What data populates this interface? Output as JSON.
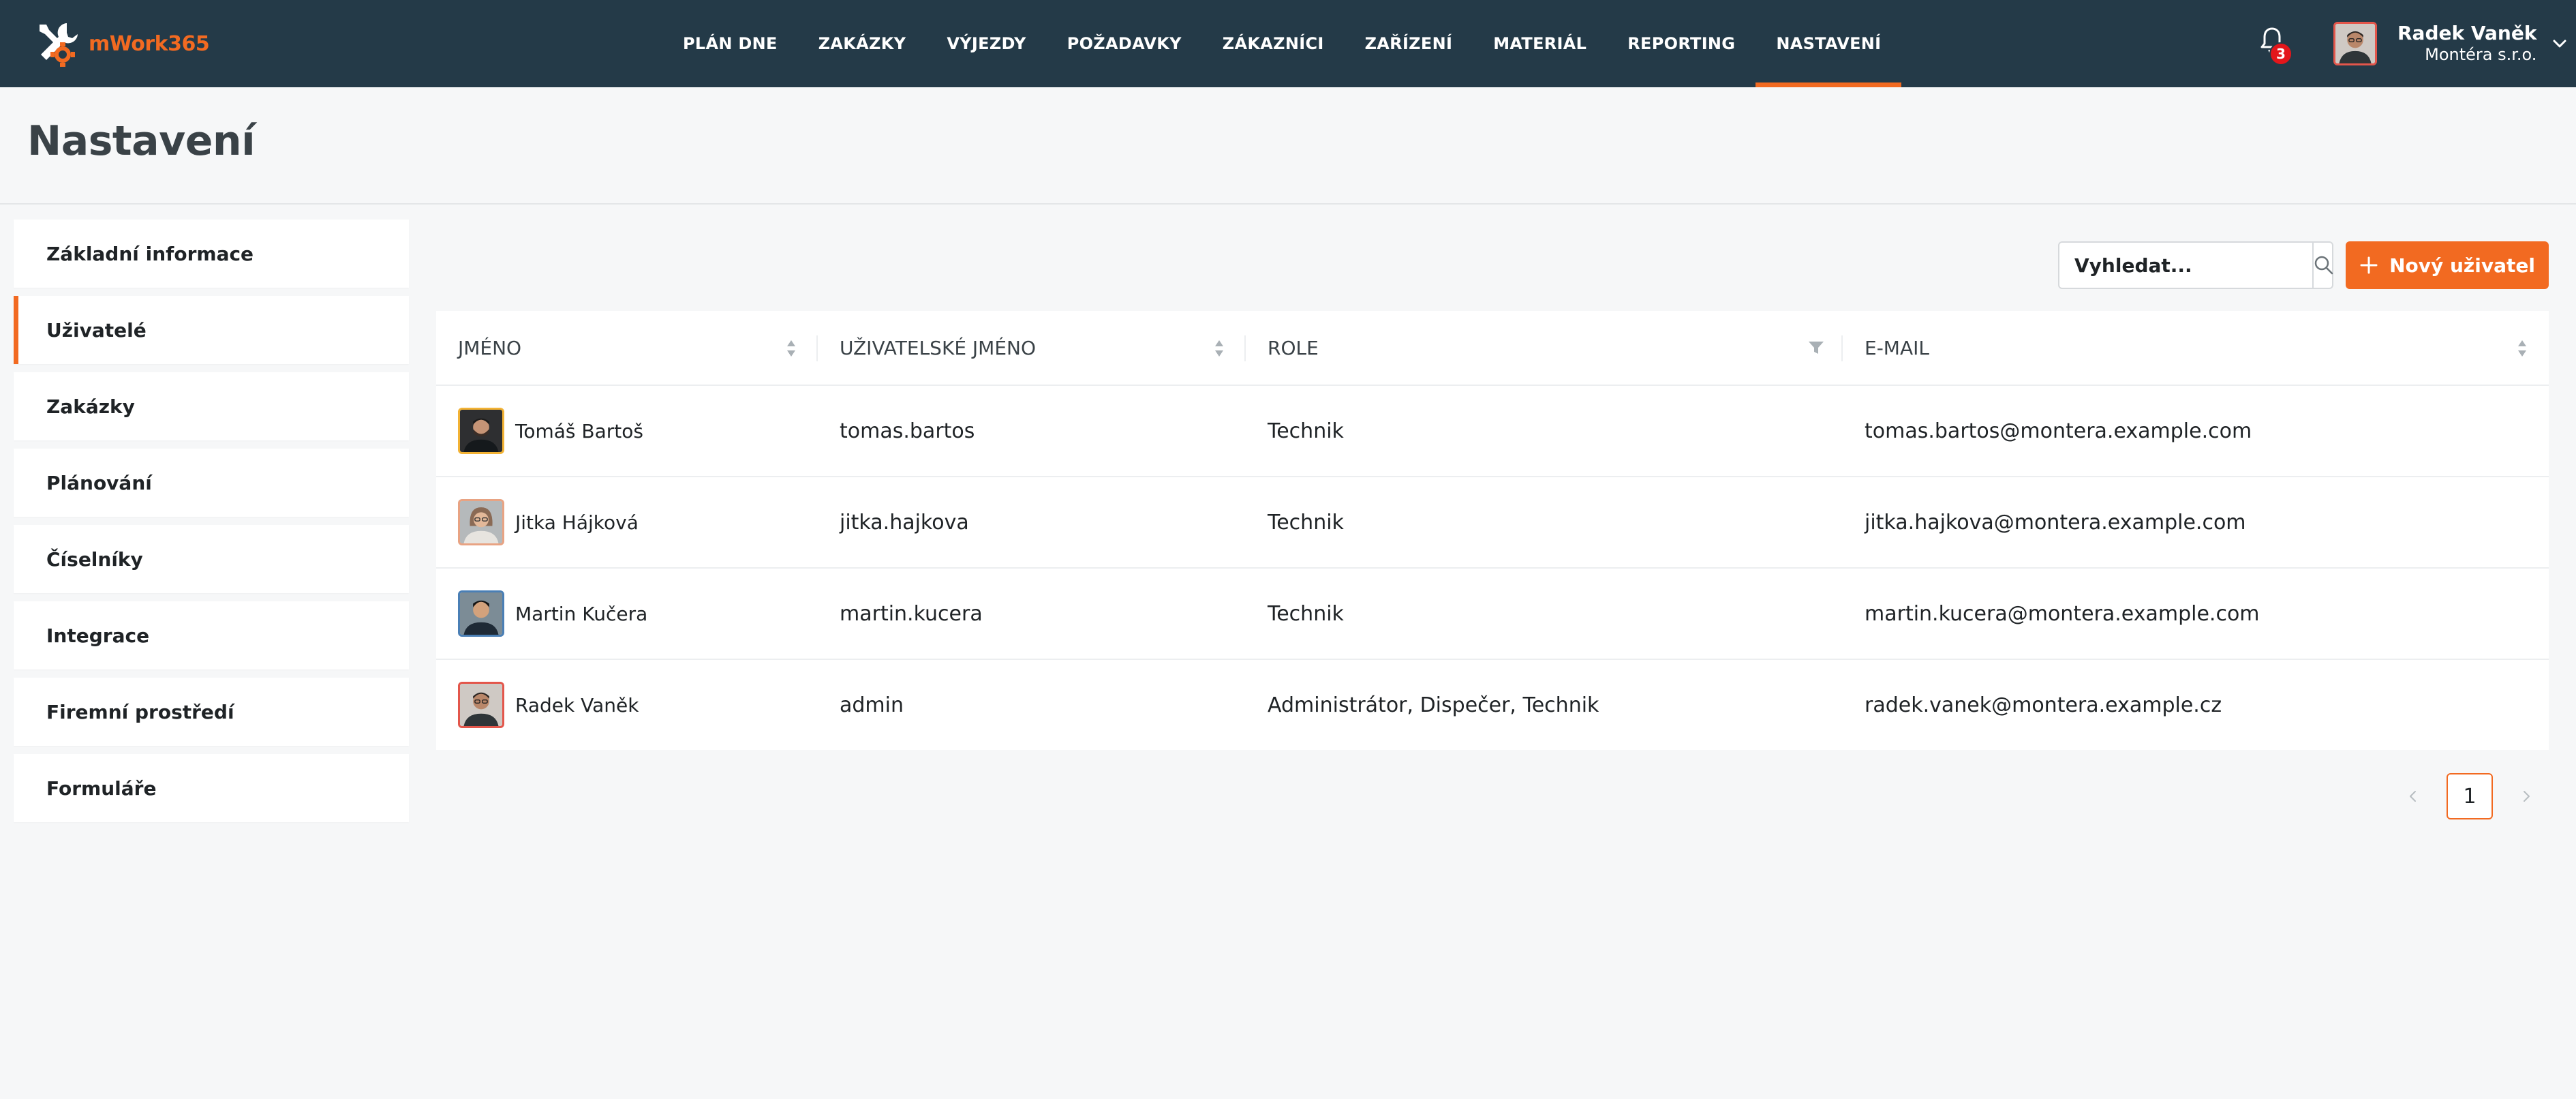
{
  "brand": {
    "name": "mWork365",
    "accent": "#f26a21",
    "nav_bg": "#243a48"
  },
  "nav": {
    "items": [
      {
        "label": "PLÁN DNE"
      },
      {
        "label": "ZAKÁZKY"
      },
      {
        "label": "VÝJEZDY"
      },
      {
        "label": "POŽADAVKY"
      },
      {
        "label": "ZÁKAZNÍCI"
      },
      {
        "label": "ZAŘÍZENÍ"
      },
      {
        "label": "MATERIÁL"
      },
      {
        "label": "REPORTING"
      },
      {
        "label": "NASTAVENÍ"
      }
    ],
    "active": "NASTAVENÍ"
  },
  "notifications": {
    "icon": "bell-icon",
    "count": "3"
  },
  "user": {
    "name": "Radek Vaněk",
    "company": "Montéra s.r.o."
  },
  "page": {
    "title": "Nastavení"
  },
  "sidebar": {
    "items": [
      {
        "label": "Základní informace"
      },
      {
        "label": "Uživatelé"
      },
      {
        "label": "Zakázky"
      },
      {
        "label": "Plánování"
      },
      {
        "label": "Číselníky"
      },
      {
        "label": "Integrace"
      },
      {
        "label": "Firemní prostředí"
      },
      {
        "label": "Formuláře"
      }
    ],
    "active": "Uživatelé"
  },
  "toolbar": {
    "search_placeholder": "Vyhledat...",
    "search_icon": "search-icon",
    "new_user_label": "Nový uživatel",
    "new_user_icon": "plus-icon"
  },
  "table": {
    "columns": [
      {
        "label": "JMÉNO",
        "control": "sort"
      },
      {
        "label": "UŽIVATELSKÉ JMÉNO",
        "control": "sort"
      },
      {
        "label": "ROLE",
        "control": "filter"
      },
      {
        "label": "E-MAIL",
        "control": "sort"
      }
    ],
    "rows": [
      {
        "name": "Tomáš Bartoš",
        "username": "tomas.bartos",
        "role": "Technik",
        "email": "tomas.bartos@montera.example.com",
        "avatar_border": "#f2b234"
      },
      {
        "name": "Jitka Hájková",
        "username": "jitka.hajkova",
        "role": "Technik",
        "email": "jitka.hajkova@montera.example.com",
        "avatar_border": "#e8a383"
      },
      {
        "name": "Martin Kučera",
        "username": "martin.kucera",
        "role": "Technik",
        "email": "martin.kucera@montera.example.com",
        "avatar_border": "#4a7fb5"
      },
      {
        "name": "Radek Vaněk",
        "username": "admin",
        "role": "Administrátor, Dispečer, Technik",
        "email": "radek.vanek@montera.example.cz",
        "avatar_border": "#e3564b"
      }
    ]
  },
  "pagination": {
    "current": "1",
    "prev_icon": "chevron-left-icon",
    "next_icon": "chevron-right-icon"
  }
}
